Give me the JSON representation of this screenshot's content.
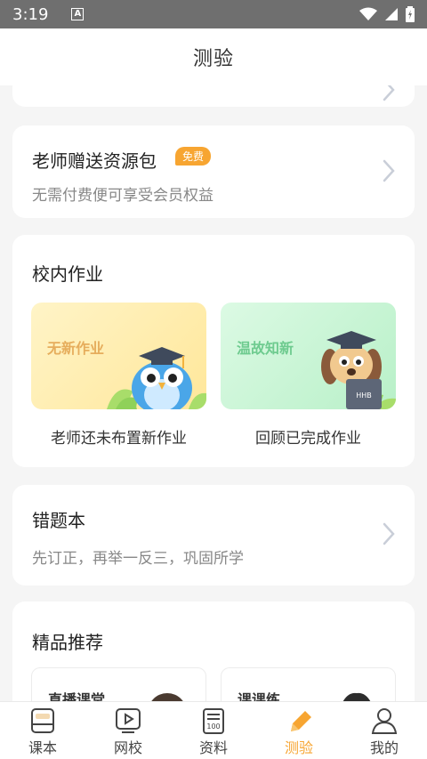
{
  "status": {
    "time": "3:19",
    "notif": "A"
  },
  "header": {
    "title": "测验"
  },
  "promo": {
    "title": "老师赠送资源包",
    "badge": "免费",
    "subtitle": "无需付费便可享受会员权益"
  },
  "homework": {
    "title": "校内作业",
    "tiles": [
      {
        "label": "无新作业",
        "caption": "老师还未布置新作业"
      },
      {
        "label": "温故知新",
        "caption": "回顾已完成作业"
      }
    ]
  },
  "mistakes": {
    "title": "错题本",
    "subtitle": "先订正，再举一反三，巩固所学"
  },
  "recommend": {
    "title": "精品推荐",
    "items": [
      {
        "label": "直播课堂"
      },
      {
        "label": "课课练"
      }
    ]
  },
  "tabs": [
    {
      "label": "课本",
      "icon": "book-icon"
    },
    {
      "label": "网校",
      "icon": "play-icon"
    },
    {
      "label": "资料",
      "icon": "document-icon"
    },
    {
      "label": "测验",
      "icon": "pen-icon",
      "active": true
    },
    {
      "label": "我的",
      "icon": "person-icon"
    }
  ],
  "colors": {
    "accent": "#f7a531",
    "status_bar": "#6f6f6f",
    "background": "#f5f5f5"
  }
}
